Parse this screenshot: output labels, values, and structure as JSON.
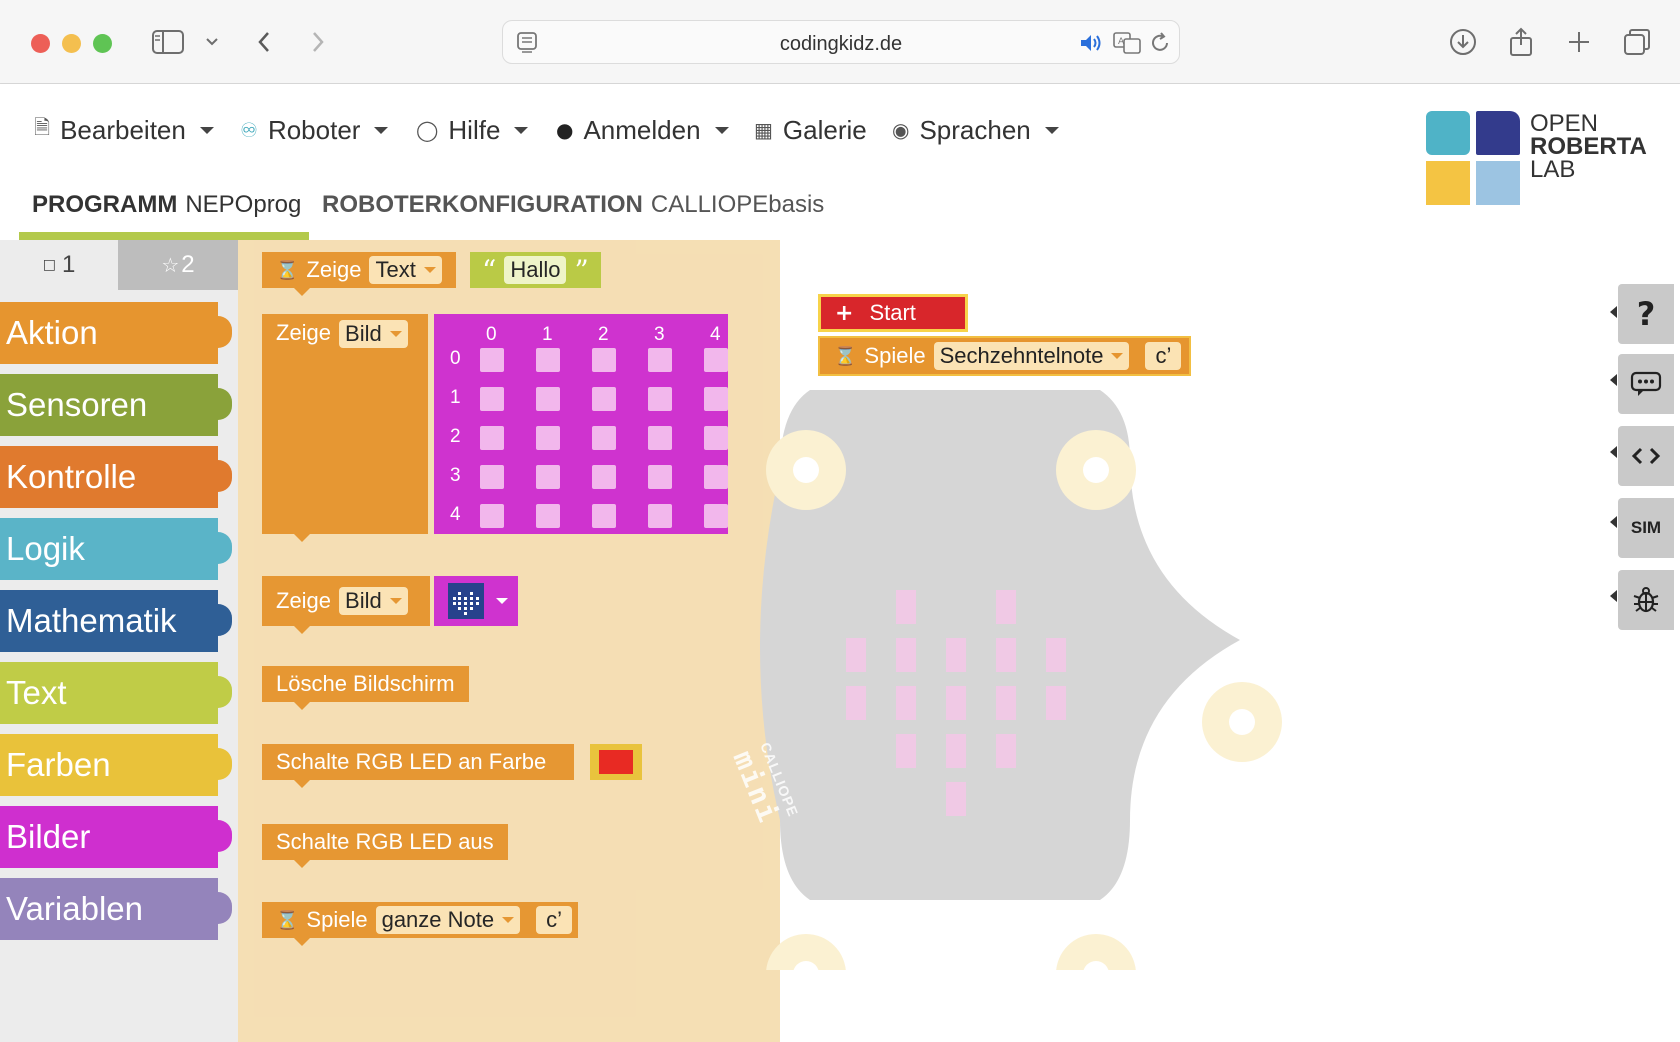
{
  "browser": {
    "url": "codingkidz.de"
  },
  "menu": {
    "items": [
      {
        "label": "Bearbeiten"
      },
      {
        "label": "Roboter"
      },
      {
        "label": "Hilfe"
      },
      {
        "label": "Anmelden"
      },
      {
        "label": "Galerie"
      },
      {
        "label": "Sprachen"
      }
    ]
  },
  "tabs": {
    "program_label": "PROGRAMM",
    "program_name": "NEPOprog",
    "config_label": "ROBOTERKONFIGURATION",
    "config_name": "CALLIOPEbasis"
  },
  "logo": {
    "line1": "OPEN",
    "line2": "ROBERTA",
    "line3": "LAB"
  },
  "level_tabs": [
    "1",
    "2"
  ],
  "categories": [
    {
      "label": "Aktion",
      "color": "#e6952f"
    },
    {
      "label": "Sensoren",
      "color": "#8aa23a"
    },
    {
      "label": "Kontrolle",
      "color": "#e07a2e"
    },
    {
      "label": "Logik",
      "color": "#5ab4c8"
    },
    {
      "label": "Mathematik",
      "color": "#2f5f96"
    },
    {
      "label": "Text",
      "color": "#c0cc47"
    },
    {
      "label": "Farben",
      "color": "#e9c23a"
    },
    {
      "label": "Bilder",
      "color": "#cf2fcf"
    },
    {
      "label": "Variablen",
      "color": "#9484bb"
    }
  ],
  "flyout": {
    "show_text": {
      "label": "Zeige",
      "mode": "Text",
      "value": "Hallo"
    },
    "show_image": {
      "label": "Zeige",
      "mode": "Bild",
      "col_headers": [
        "0",
        "1",
        "2",
        "3",
        "4"
      ],
      "row_headers": [
        "0",
        "1",
        "2",
        "3",
        "4"
      ]
    },
    "show_image2": {
      "label": "Zeige",
      "mode": "Bild"
    },
    "clear": {
      "label": "Lösche Bildschirm"
    },
    "rgb_on": {
      "label": "Schalte RGB LED an Farbe",
      "color": "#e8261f"
    },
    "rgb_off": {
      "label": "Schalte RGB LED aus"
    },
    "play": {
      "label": "Spiele",
      "note": "ganze Note",
      "tone": "c’"
    }
  },
  "canvas": {
    "start": {
      "label": "Start"
    },
    "play": {
      "label": "Spiele",
      "note": "Sechzehntelnote",
      "tone": "c’"
    },
    "board_text_1": "CALLIOPE",
    "board_text_2": "mini"
  },
  "side_buttons": [
    {
      "label": "?",
      "icon": "help-icon"
    },
    {
      "label": "…",
      "icon": "chat-icon"
    },
    {
      "label": "<>",
      "icon": "code-icon"
    },
    {
      "label": "SIM",
      "icon": "sim-icon"
    },
    {
      "label": "bug",
      "icon": "bug-icon"
    }
  ]
}
